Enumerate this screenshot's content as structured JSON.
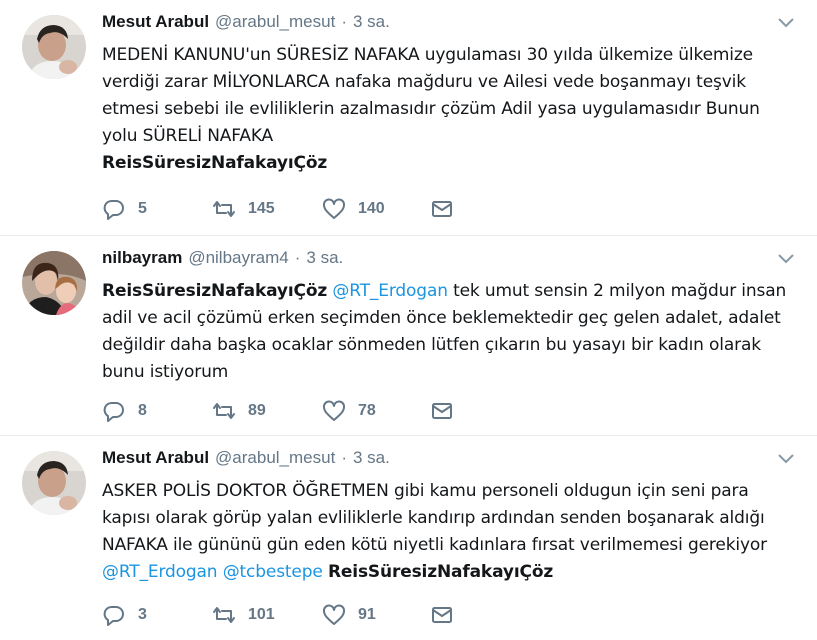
{
  "tweets": [
    {
      "fullname": "Mesut Arabul",
      "username": "@arabul_mesut",
      "separator": "·",
      "time": "3 sa.",
      "segments": [
        {
          "type": "text",
          "value": "MEDENİ KANUNU'un SÜRESİZ NAFAKA uygulaması 30 yılda ülkemize ülkemize verdiği zarar MİLYONLARCA nafaka mağduru ve Ailesi vede boşanmayı teşvik etmesi sebebi ile evliliklerin azalmasıdır çözüm Adil yasa uygulamasıdır Bunun yolu SÜRELİ NAFAKA"
        },
        {
          "type": "tag",
          "value": "ReisSüresizNafakayıÇöz"
        }
      ],
      "reply_count": "5",
      "retweet_count": "145",
      "like_count": "140"
    },
    {
      "fullname": "nilbayram",
      "username": "@nilbayram4",
      "separator": "·",
      "time": "3 sa.",
      "segments": [
        {
          "type": "tag",
          "value": "ReisSüresizNafakayıÇöz"
        },
        {
          "type": "mention",
          "value": "@RT_Erdogan"
        },
        {
          "type": "text",
          "value": "tek umut sensin 2 milyon mağdur insan adil ve acil çözümü erken seçimden önce beklemektedir geç gelen adalet, adalet değildir daha başka ocaklar sönmeden lütfen çıkarın bu yasayı bir kadın olarak bunu istiyorum"
        }
      ],
      "reply_count": "8",
      "retweet_count": "89",
      "like_count": "78"
    },
    {
      "fullname": "Mesut Arabul",
      "username": "@arabul_mesut",
      "separator": "·",
      "time": "3 sa.",
      "segments": [
        {
          "type": "text",
          "value": "ASKER POLİS DOKTOR ÖĞRETMEN gibi kamu personeli oldugun için seni para kapısı olarak görüp yalan evliliklerle kandırıp ardından senden boşanarak aldığı NAFAKA ile gününü gün eden kötü niyetli kadınlara fırsat verilmemesi gerekiyor"
        },
        {
          "type": "mention",
          "value": "@RT_Erdogan"
        },
        {
          "type": "mention",
          "value": "@tcbestepe"
        },
        {
          "type": "tag",
          "value": "ReisSüresizNafakayıÇöz"
        }
      ],
      "reply_count": "3",
      "retweet_count": "101",
      "like_count": "91"
    }
  ],
  "icons": {
    "reply": "reply-icon",
    "retweet": "retweet-icon",
    "like": "heart-icon",
    "dm": "envelope-icon",
    "caret": "chevron-down-icon"
  },
  "colors": {
    "text": "#14171a",
    "muted": "#657786",
    "link": "#1b95e0",
    "divider": "#e6ecf0"
  }
}
